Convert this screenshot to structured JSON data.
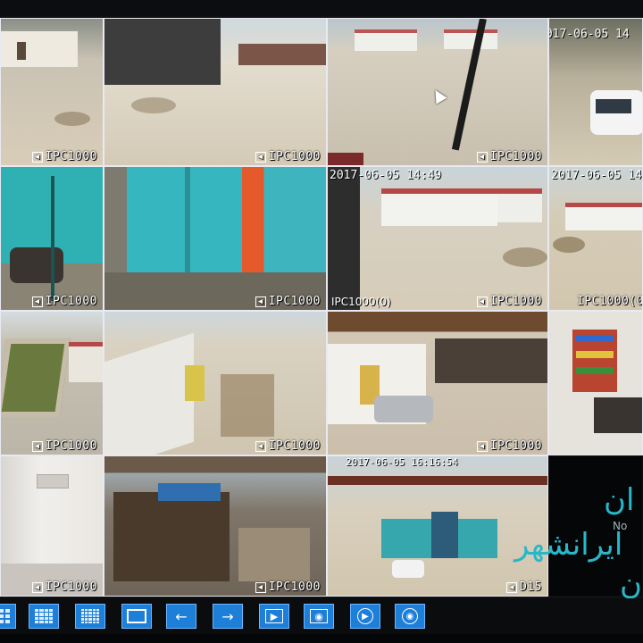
{
  "cameras": {
    "c1": {
      "label": "IPC1000"
    },
    "c2": {
      "label": "IPC1000"
    },
    "c3": {
      "label": "IPC1000",
      "timestamp": "2017-06-05 14"
    },
    "c4": {
      "label": ""
    },
    "c5": {
      "label": "IPC1000"
    },
    "c6": {
      "label": "IPC1000"
    },
    "c7": {
      "label": "IPC1000",
      "timestamp": "2017-06-05 14:49",
      "left_label": "IPC1000(0)"
    },
    "c8": {
      "label": "IPC1000(0",
      "timestamp": "2017-06-05 14"
    },
    "c9": {
      "label": "IPC1000"
    },
    "c10": {
      "label": "IPC1000"
    },
    "c11": {
      "label": "IPC1000"
    },
    "c12": {
      "label": ""
    },
    "c13": {
      "label": "IPC1000"
    },
    "c14": {
      "label": "IPC1000"
    },
    "c15": {
      "label": "D15",
      "timestamp": "2017-06-05 16:16:54"
    },
    "c16": {
      "label": ""
    }
  },
  "overlay": {
    "line1": "ان",
    "line2": "ایرانشهر",
    "line3": "ن",
    "small": "No"
  },
  "toolbar": {
    "buttons": [
      {
        "icon": "layout-9-icon"
      },
      {
        "icon": "layout-16-icon"
      },
      {
        "icon": "layout-25-icon"
      },
      {
        "icon": "fullscreen-icon"
      },
      {
        "icon": "arrow-left-icon",
        "glyph": "←"
      },
      {
        "icon": "arrow-right-icon",
        "glyph": "→"
      },
      {
        "icon": "play-icon",
        "glyph": "▶"
      },
      {
        "icon": "record-icon",
        "glyph": "◉"
      },
      {
        "icon": "playback-icon",
        "glyph": "▶"
      },
      {
        "icon": "stop-icon",
        "glyph": "◉"
      }
    ]
  },
  "colors": {
    "accent": "#1e7fd9",
    "overlay_text": "#28b7c9"
  }
}
